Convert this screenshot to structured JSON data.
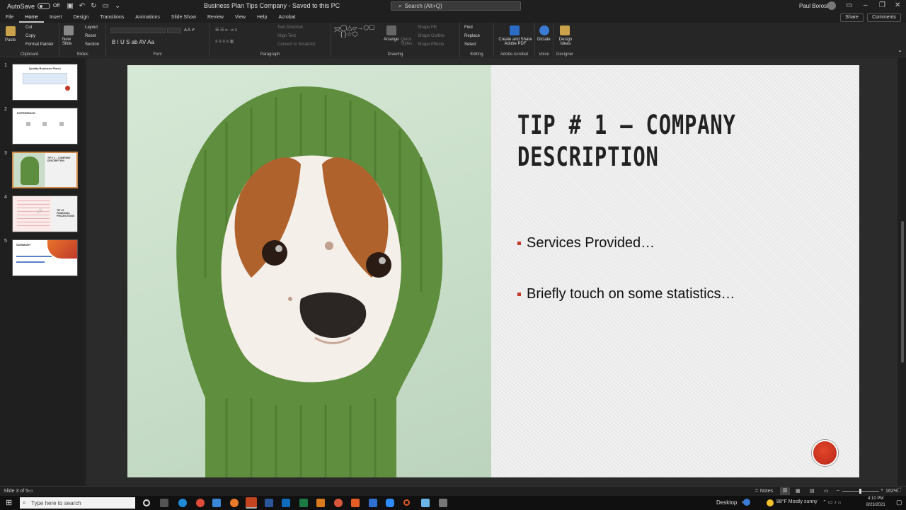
{
  "titlebar": {
    "autosave_label": "AutoSave",
    "autosave_state": "Off",
    "doc_title": "Business Plan Tips Company  -  Saved to this PC",
    "search_placeholder": "Search (Alt+Q)",
    "user_name": "Paul Borosky"
  },
  "tabs": [
    "File",
    "Home",
    "Insert",
    "Design",
    "Transitions",
    "Animations",
    "Slide Show",
    "Review",
    "View",
    "Help",
    "Acrobat"
  ],
  "active_tab": "Home",
  "share_label": "Share",
  "comments_label": "Comments",
  "ribbon": {
    "clipboard": {
      "label": "Clipboard",
      "paste": "Paste",
      "cut": "Cut",
      "copy": "Copy",
      "format_painter": "Format Painter"
    },
    "slides": {
      "label": "Slides",
      "new_slide": "New Slide",
      "layout": "Layout",
      "reset": "Reset",
      "section": "Section"
    },
    "font": {
      "label": "Font"
    },
    "paragraph": {
      "label": "Paragraph",
      "text_direction": "Text Direction",
      "align_text": "Align Text",
      "convert_smartart": "Convert to SmartArt"
    },
    "drawing": {
      "label": "Drawing",
      "arrange": "Arrange",
      "quick_styles": "Quick Styles",
      "shape_fill": "Shape Fill",
      "shape_outline": "Shape Outline",
      "shape_effects": "Shape Effects"
    },
    "editing": {
      "label": "Editing",
      "find": "Find",
      "replace": "Replace",
      "select": "Select"
    },
    "adobe": {
      "label": "Adobe Acrobat",
      "create_share": "Create and Share Adobe PDF"
    },
    "voice": {
      "label": "Voice",
      "dictate": "Dictate"
    },
    "designer": {
      "label": "Designer",
      "design_ideas": "Design Ideas"
    }
  },
  "thumbnails": [
    {
      "num": "1",
      "title": "Quality Business Plan's"
    },
    {
      "num": "2",
      "title": "EXPERIENCE"
    },
    {
      "num": "3",
      "title": "TIP # 1 – COMPANY DESCRIPTION"
    },
    {
      "num": "4",
      "title": "TIP #2 FINANCIAL PROJECTIONS"
    },
    {
      "num": "5",
      "title": "SUMMARY"
    }
  ],
  "selected_slide": 3,
  "slide": {
    "title": "TIP # 1 – COMPANY DESCRIPTION",
    "bullets": [
      "Services Provided…",
      "Briefly touch on some statistics…"
    ]
  },
  "status": {
    "slide_indicator": "Slide 3 of 5",
    "notes": "Notes",
    "zoom": "162%"
  },
  "taskbar": {
    "search_placeholder": "Type here to search",
    "desktop": "Desktop",
    "weather": "88°F  Mostly sunny",
    "time": "4:10 PM",
    "date": "8/23/2021"
  }
}
